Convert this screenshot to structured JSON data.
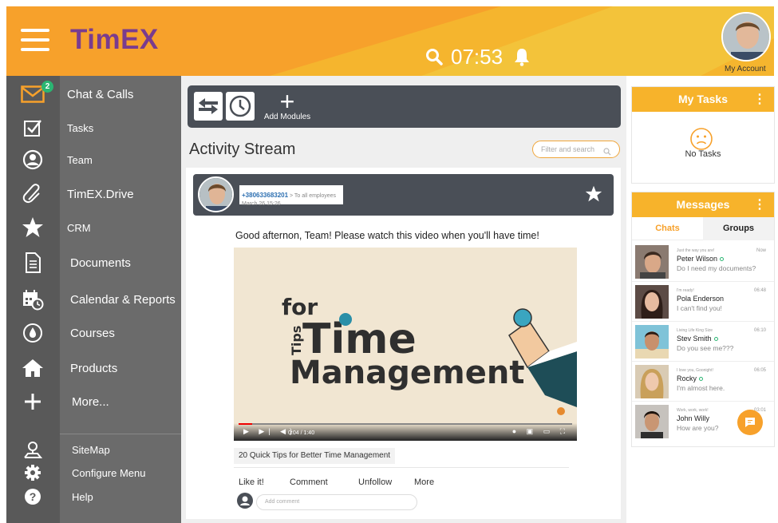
{
  "header": {
    "logo": "TimEX",
    "time": "07:53",
    "account_label": "My Account"
  },
  "sidebar": {
    "mail_badge": "2",
    "items": [
      {
        "label": "Chat & Calls",
        "icon": "mail-icon"
      },
      {
        "label": "Tasks",
        "icon": "checkbox-icon"
      },
      {
        "label": "Team",
        "icon": "user-circle-icon"
      },
      {
        "label": "TimEX.Drive",
        "icon": "paperclip-icon"
      },
      {
        "label": "CRM",
        "icon": "star-icon"
      },
      {
        "label": "Documents",
        "icon": "document-icon"
      },
      {
        "label": "Calendar & Reports",
        "icon": "calendar-icon"
      },
      {
        "label": "Courses",
        "icon": "drop-circle-icon"
      },
      {
        "label": "Products",
        "icon": "home-icon"
      },
      {
        "label": "More...",
        "icon": "plus-icon"
      }
    ],
    "bottom_items": [
      {
        "label": "SiteMap",
        "icon": "sitemap-icon"
      },
      {
        "label": "Configure Menu",
        "icon": "gear-icon"
      },
      {
        "label": "Help",
        "icon": "help-icon"
      }
    ]
  },
  "main": {
    "add_modules_label": "Add Modules",
    "title": "Activity Stream",
    "filter_placeholder": "Filter and search",
    "post": {
      "phone": "+380633683201",
      "audience": "To all employees",
      "date": "March 26 15:26",
      "text": "Good afternon, Team! Please watch this video when you'll have time!",
      "video": {
        "word_for": "for",
        "word_tips": "Tips",
        "word_time": "Time",
        "word_management": "Management",
        "time_display": "0:04 / 1:40",
        "progress": 0.04
      },
      "video_title": "20 Quick Tips for Better Time Management",
      "actions": [
        "Like it!",
        "Comment",
        "Unfollow",
        "More"
      ],
      "comment_placeholder": "Add comment"
    }
  },
  "tasks_panel": {
    "title": "My Tasks",
    "empty_text": "No Tasks"
  },
  "messages_panel": {
    "title": "Messages",
    "tabs": [
      "Chats",
      "Groups"
    ],
    "items": [
      {
        "status": "Just the way you are!",
        "time": "Now",
        "name": "Peter Wilson",
        "text": "Do I need my documents?",
        "online": true
      },
      {
        "status": "I'm ready!",
        "time": "06:48",
        "name": "Pola Enderson",
        "text": "I can't find you!",
        "online": false
      },
      {
        "status": "Living Life King Size",
        "time": "06:10",
        "name": "Stev Smith",
        "text": "Do you see me???",
        "online": true
      },
      {
        "status": "I love you, Goonight!",
        "time": "06:05",
        "name": "Rocky",
        "text": "I'm almost here.",
        "online": true
      },
      {
        "status": "Work, work, work!",
        "time": "03:01",
        "name": "John Willy",
        "text": "How are you?",
        "online": false
      }
    ]
  },
  "colors": {
    "orange": "#f7a12b",
    "yellow": "#f7b32b",
    "purple": "#7a3c8e",
    "sidebar": "#6b6b6b",
    "dark_bar": "#4a4f57",
    "online_green": "#2bb673"
  }
}
